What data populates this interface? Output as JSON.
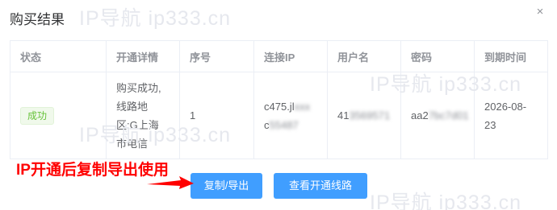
{
  "dialog": {
    "title": "购买结果",
    "close_glyph": "×"
  },
  "watermark": "IP导航 ip333.cn",
  "table": {
    "headers": [
      "状态",
      "开通详情",
      "序号",
      "连接IP",
      "用户名",
      "密码",
      "到期时间"
    ],
    "row": {
      "status": "成功",
      "detail_lines": [
        "购买成功,",
        "线路地",
        "区:G上海",
        "市电信"
      ],
      "index": "1",
      "ip_visible": "c475.jl",
      "ip_blurred": "xxx",
      "ip_line2_visible": "c",
      "ip_line2_blurred": "55487",
      "username_visible": "41",
      "username_blurred": "3569571",
      "password_visible": "aa2",
      "password_blurred": "7bc7d01",
      "expiry_lines": [
        "2026-08-",
        "23"
      ]
    }
  },
  "annotation": "IP开通后复制导出使用",
  "buttons": {
    "copy_export": "复制/导出",
    "view_lines": "查看开通线路"
  },
  "colors": {
    "primary": "#409eff",
    "success": "#67c23a",
    "annotation": "#ff0000"
  }
}
